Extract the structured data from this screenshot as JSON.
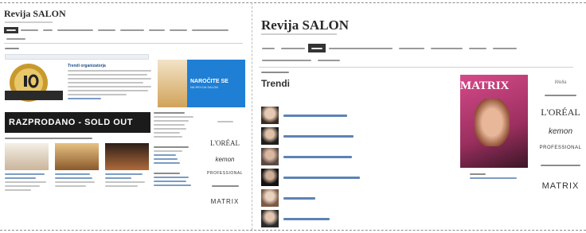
{
  "left": {
    "site_title": "Revija SALON",
    "trends_heading": "Trendi organizatorja",
    "ad_subscribe": "NAROČITE SE",
    "ad_subscribe_sub": "NA REVIJA SALON",
    "sold_out_banner": "RAZPRODANO - SOLD OUT",
    "brand_loreal": "L'ORÉAL",
    "brand_kemon": "kemon",
    "brand_proyou": "PROFESSIONAL",
    "brand_matrix": "MATRIX"
  },
  "right": {
    "site_title": "Revija SALON",
    "page_heading": "Trendi",
    "magazine_masthead": "MATRIX",
    "brand_wella": "Wella",
    "brand_loreal": "L'ORÉAL",
    "brand_kemon": "kemon",
    "brand_proyou": "PROFESSIONAL",
    "brand_matrix": "MATRIX"
  },
  "colors": {
    "link_blue": "#5d83b5",
    "ad_blue": "#1f7fd4",
    "nav_active": "#333333",
    "magazine_pink": "#d64a8a"
  }
}
